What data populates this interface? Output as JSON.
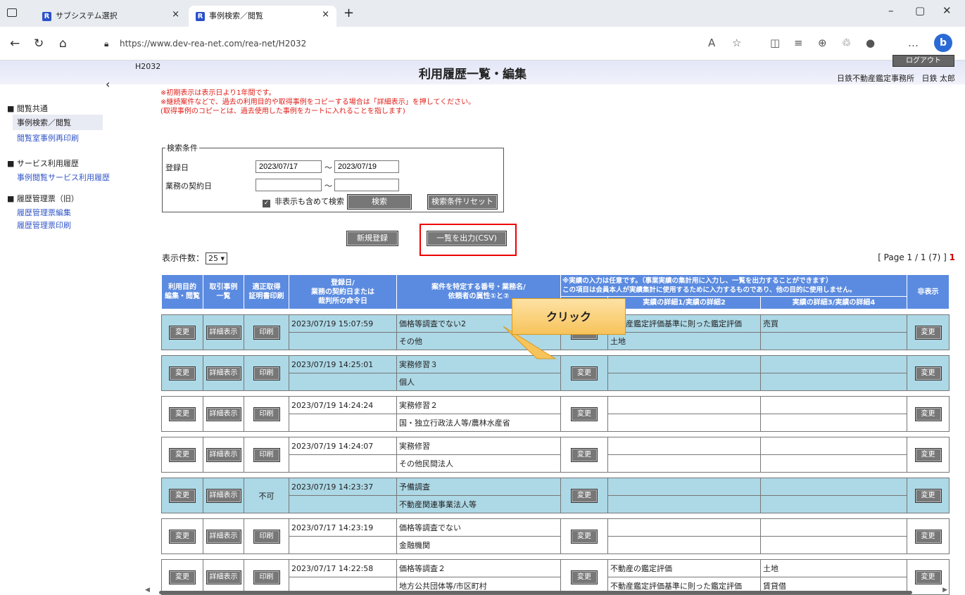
{
  "browser": {
    "tabs": [
      {
        "title": "サブシステム選択"
      },
      {
        "title": "事例検索／閲覧"
      }
    ],
    "url": "https://www.dev-rea-net.com/rea-net/H2032"
  },
  "header": {
    "page_id": "H2032",
    "title": "利用履歴一覧・編集",
    "logout": "ログアウト",
    "office": "日鉄不動産鑑定事務所",
    "user": "日鉄 太郎"
  },
  "sidebar": {
    "groups": [
      {
        "label": "■ 閲覧共通",
        "items": [
          "事例検索／閲覧",
          "閲覧室事例再印刷"
        ]
      },
      {
        "label": "■ サービス利用履歴",
        "items": [
          "事例閲覧サービス利用履歴"
        ]
      },
      {
        "label": "■ 履歴管理票（旧）",
        "items": [
          "履歴管理票編集",
          "履歴管理票印刷"
        ]
      }
    ]
  },
  "notes": [
    "※初期表示は表示日より1年間です。",
    "※継続案件などで、過去の利用目的や取得事例をコピーする場合は「詳細表示」を押してください。",
    "(取得事例のコピーとは、過去使用した事例をカートに入れることを指します)"
  ],
  "search": {
    "legend": "検索条件",
    "reg_label": "登録日",
    "reg_from": "2023/07/17",
    "reg_to": "2023/07/19",
    "contract_label": "業務の契約日",
    "contract_from": "",
    "contract_to": "",
    "tilde": "～",
    "include_hidden": "非表示も含めて検索",
    "search_btn": "検索",
    "reset_btn": "検索条件リセット"
  },
  "actions": {
    "new": "新規登録",
    "csv": "一覧を出力(CSV)"
  },
  "list": {
    "count_label": "表示件数：",
    "count_value": "25",
    "pager_prefix": "[ Page 1 / 1 (7) ]",
    "pager_current": "1"
  },
  "table": {
    "headers": {
      "purpose": "利用目的\n編集・閲覧",
      "cases": "取引事例\n一覧",
      "cert": "適正取得\n証明書印刷",
      "date": "登録日/\n業務の契約日または\n裁判所の命令日",
      "case": "案件を特定する番号・業務名/\n依頼者の属性①と②",
      "notice": "※実績の入力は任意です。（事業実績の集計用に入力し、一覧を出力することができます）\nこの項目は会員本人が実績集計に使用するために入力するものであり、他の目的に使用しません。",
      "detail12": "実績の詳細1/実績の詳細2",
      "detail34": "実績の詳細3/実績の詳細4",
      "hide": "非表示"
    },
    "btn_change": "変更",
    "btn_detail": "詳細表示",
    "btn_print": "印刷",
    "rows": [
      {
        "hl": true,
        "date": "2023/07/19 15:07:59",
        "name": "価格等調査でない2",
        "client": "その他",
        "d1": "不動産鑑定評価基準に則った鑑定評価",
        "d2": "土地",
        "d3": "売買",
        "d4": "",
        "cert": "print"
      },
      {
        "hl": true,
        "date": "2023/07/19 14:25:01",
        "name": "実務修習３",
        "client": "個人",
        "d1": "",
        "d2": "",
        "d3": "",
        "d4": "",
        "cert": "print"
      },
      {
        "hl": false,
        "date": "2023/07/19 14:24:24",
        "name": "実務修習２",
        "client": "国・独立行政法人等/農林水産省",
        "d1": "",
        "d2": "",
        "d3": "",
        "d4": "",
        "cert": "print"
      },
      {
        "hl": false,
        "date": "2023/07/19 14:24:07",
        "name": "実務修習",
        "client": "その他民間法人",
        "d1": "",
        "d2": "",
        "d3": "",
        "d4": "",
        "cert": "print"
      },
      {
        "hl": true,
        "date": "2023/07/19 14:23:37",
        "name": "予備調査",
        "client": "不動産関連事業法人等",
        "d1": "",
        "d2": "",
        "d3": "",
        "d4": "",
        "cert": "不可"
      },
      {
        "hl": false,
        "date": "2023/07/17 14:23:19",
        "name": "価格等調査でない",
        "client": "金融機関",
        "d1": "",
        "d2": "",
        "d3": "",
        "d4": "",
        "cert": "print"
      },
      {
        "hl": false,
        "date": "2023/07/17 14:22:58",
        "name": "価格等調査２",
        "client": "地方公共団体等/市区町村",
        "d1": "不動産の鑑定評価",
        "d2": "不動産鑑定評価基準に則った鑑定評価",
        "d3": "土地",
        "d4": "賃貸借",
        "cert": "print"
      }
    ]
  },
  "callout": {
    "text": "クリック"
  },
  "colors": {
    "header_blue": "#5b8be0",
    "row_highlight": "#add8e6",
    "note_red": "#e0201b",
    "callout": "#f7c35b"
  }
}
